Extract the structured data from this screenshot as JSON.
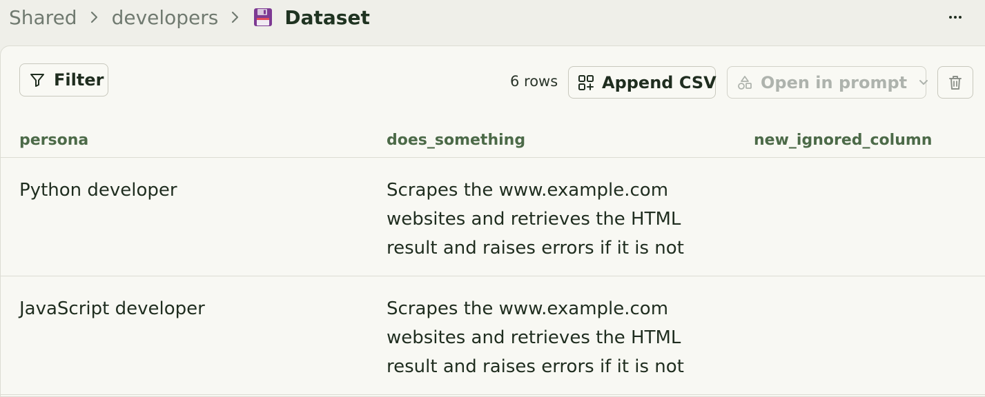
{
  "breadcrumb": {
    "items": [
      "Shared",
      "developers"
    ],
    "current": "Dataset"
  },
  "toolbar": {
    "filter_label": "Filter",
    "row_count": "6 rows",
    "append_label": "Append CSV",
    "open_in_prompt_label": "Open in prompt"
  },
  "table": {
    "columns": [
      "persona",
      "does_something",
      "new_ignored_column"
    ],
    "rows": [
      {
        "persona": "Python developer",
        "does_something": "Scrapes the www.example.com websites and retrieves the HTML result and raises errors if it is not",
        "new_ignored_column": ""
      },
      {
        "persona": "JavaScript developer",
        "does_something": "Scrapes the www.example.com websites and retrieves the HTML result and raises errors if it is not",
        "new_ignored_column": ""
      }
    ]
  },
  "icons": {
    "dataset": "floppy-disk-icon",
    "filter": "funnel-icon",
    "append": "append-csv-icon",
    "open_in_prompt": "shapes-icon",
    "dropdown": "chevron-down-icon",
    "delete": "trash-icon",
    "more": "more-horizontal-icon"
  },
  "colors": {
    "background": "#efefe9",
    "panel": "#f8f8f3",
    "header_text": "#4c6a48",
    "floppy": "#8a3fa0"
  }
}
